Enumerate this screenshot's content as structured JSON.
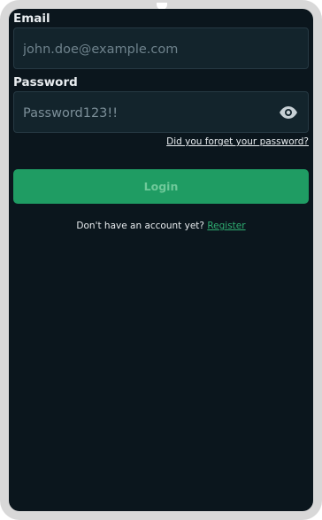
{
  "form": {
    "email_label": "Email",
    "email_placeholder": "john.doe@example.com",
    "email_value": "",
    "password_label": "Password",
    "password_value": "Password123!!",
    "password_visibility_icon": "eye-icon",
    "forgot_link": "Did you forget your password?",
    "login_button": "Login",
    "register_prompt": "Don't have an account yet?",
    "register_link": "Register"
  },
  "colors": {
    "background": "#0b161d",
    "field_background": "#13242c",
    "accent_green": "#1f9c63",
    "link_green": "#2fae72",
    "device_frame": "#d8d8d8"
  }
}
